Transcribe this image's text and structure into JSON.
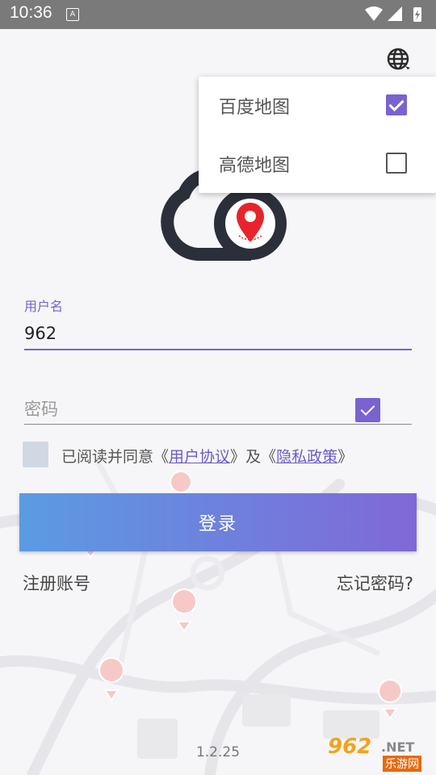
{
  "status_bar": {
    "time": "10:36",
    "notification_letter": "A"
  },
  "map_menu": {
    "items": [
      {
        "label": "百度地图",
        "checked": true
      },
      {
        "label": "高德地图",
        "checked": false
      }
    ]
  },
  "login_form": {
    "username_label": "用户名",
    "username_value": "962",
    "password_placeholder": "密码",
    "agreement": {
      "prefix": "已阅读并同意",
      "open_quote_1": "《",
      "user_agreement": "用户协议",
      "close_quote_1": "》",
      "and": "及",
      "open_quote_2": "《",
      "privacy_policy": "隐私政策",
      "close_quote_2": "》"
    },
    "login_button": "登录",
    "register_link": "注册账号",
    "forgot_link": "忘记密码?"
  },
  "version": "1.2.25",
  "watermark": {
    "number": "962",
    "net": ".NET",
    "subtitle": "乐游网"
  },
  "colors": {
    "accent": "#7a62d0",
    "button_start": "#5b9be2",
    "button_end": "#8068d7",
    "pin": "#e8242a"
  },
  "icons": [
    "globe-icon",
    "cloud-location-logo",
    "check-icon"
  ]
}
